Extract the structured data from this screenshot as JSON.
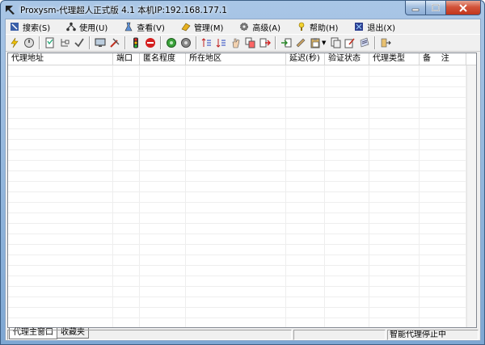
{
  "window": {
    "title": "Proxysm-代理超人正式版 4.1  本机IP:192.168.177.1"
  },
  "menu": [
    {
      "label": "搜索(S)",
      "icon": "search-icon"
    },
    {
      "label": "使用(U)",
      "icon": "network-icon"
    },
    {
      "label": "查看(V)",
      "icon": "flask-icon"
    },
    {
      "label": "管理(M)",
      "icon": "manage-icon"
    },
    {
      "label": "高级(A)",
      "icon": "gear-icon"
    },
    {
      "label": "帮助(H)",
      "icon": "help-icon"
    },
    {
      "label": "退出(X)",
      "icon": "exit-icon"
    }
  ],
  "toolbar": {
    "icons": [
      "lightning-icon",
      "power-icon",
      "checklist-icon",
      "tree-icon",
      "checkmark-icon",
      "monitor-icon",
      "tools-icon",
      "traffic-light-icon",
      "stop-icon",
      "green-circle-icon",
      "gray-circle-icon",
      "sort-asc-icon",
      "sort-desc-icon",
      "hand-icon",
      "copy-icon",
      "export-icon",
      "import-icon",
      "ruler-icon",
      "paste-icon",
      "document-icon",
      "edit-icon",
      "notepad-icon",
      "arrow-icon"
    ]
  },
  "table": {
    "columns": [
      "代理地址",
      "端口",
      "匿名程度",
      "所在地区",
      "延迟(秒)",
      "验证状态",
      "代理类型",
      "备    注"
    ],
    "rows": []
  },
  "tabs": [
    {
      "label": "代理主窗口",
      "active": true
    },
    {
      "label": "收藏夹",
      "active": false
    }
  ],
  "status": {
    "panel1": "",
    "panel2": "",
    "panel3": "智能代理停止中"
  }
}
